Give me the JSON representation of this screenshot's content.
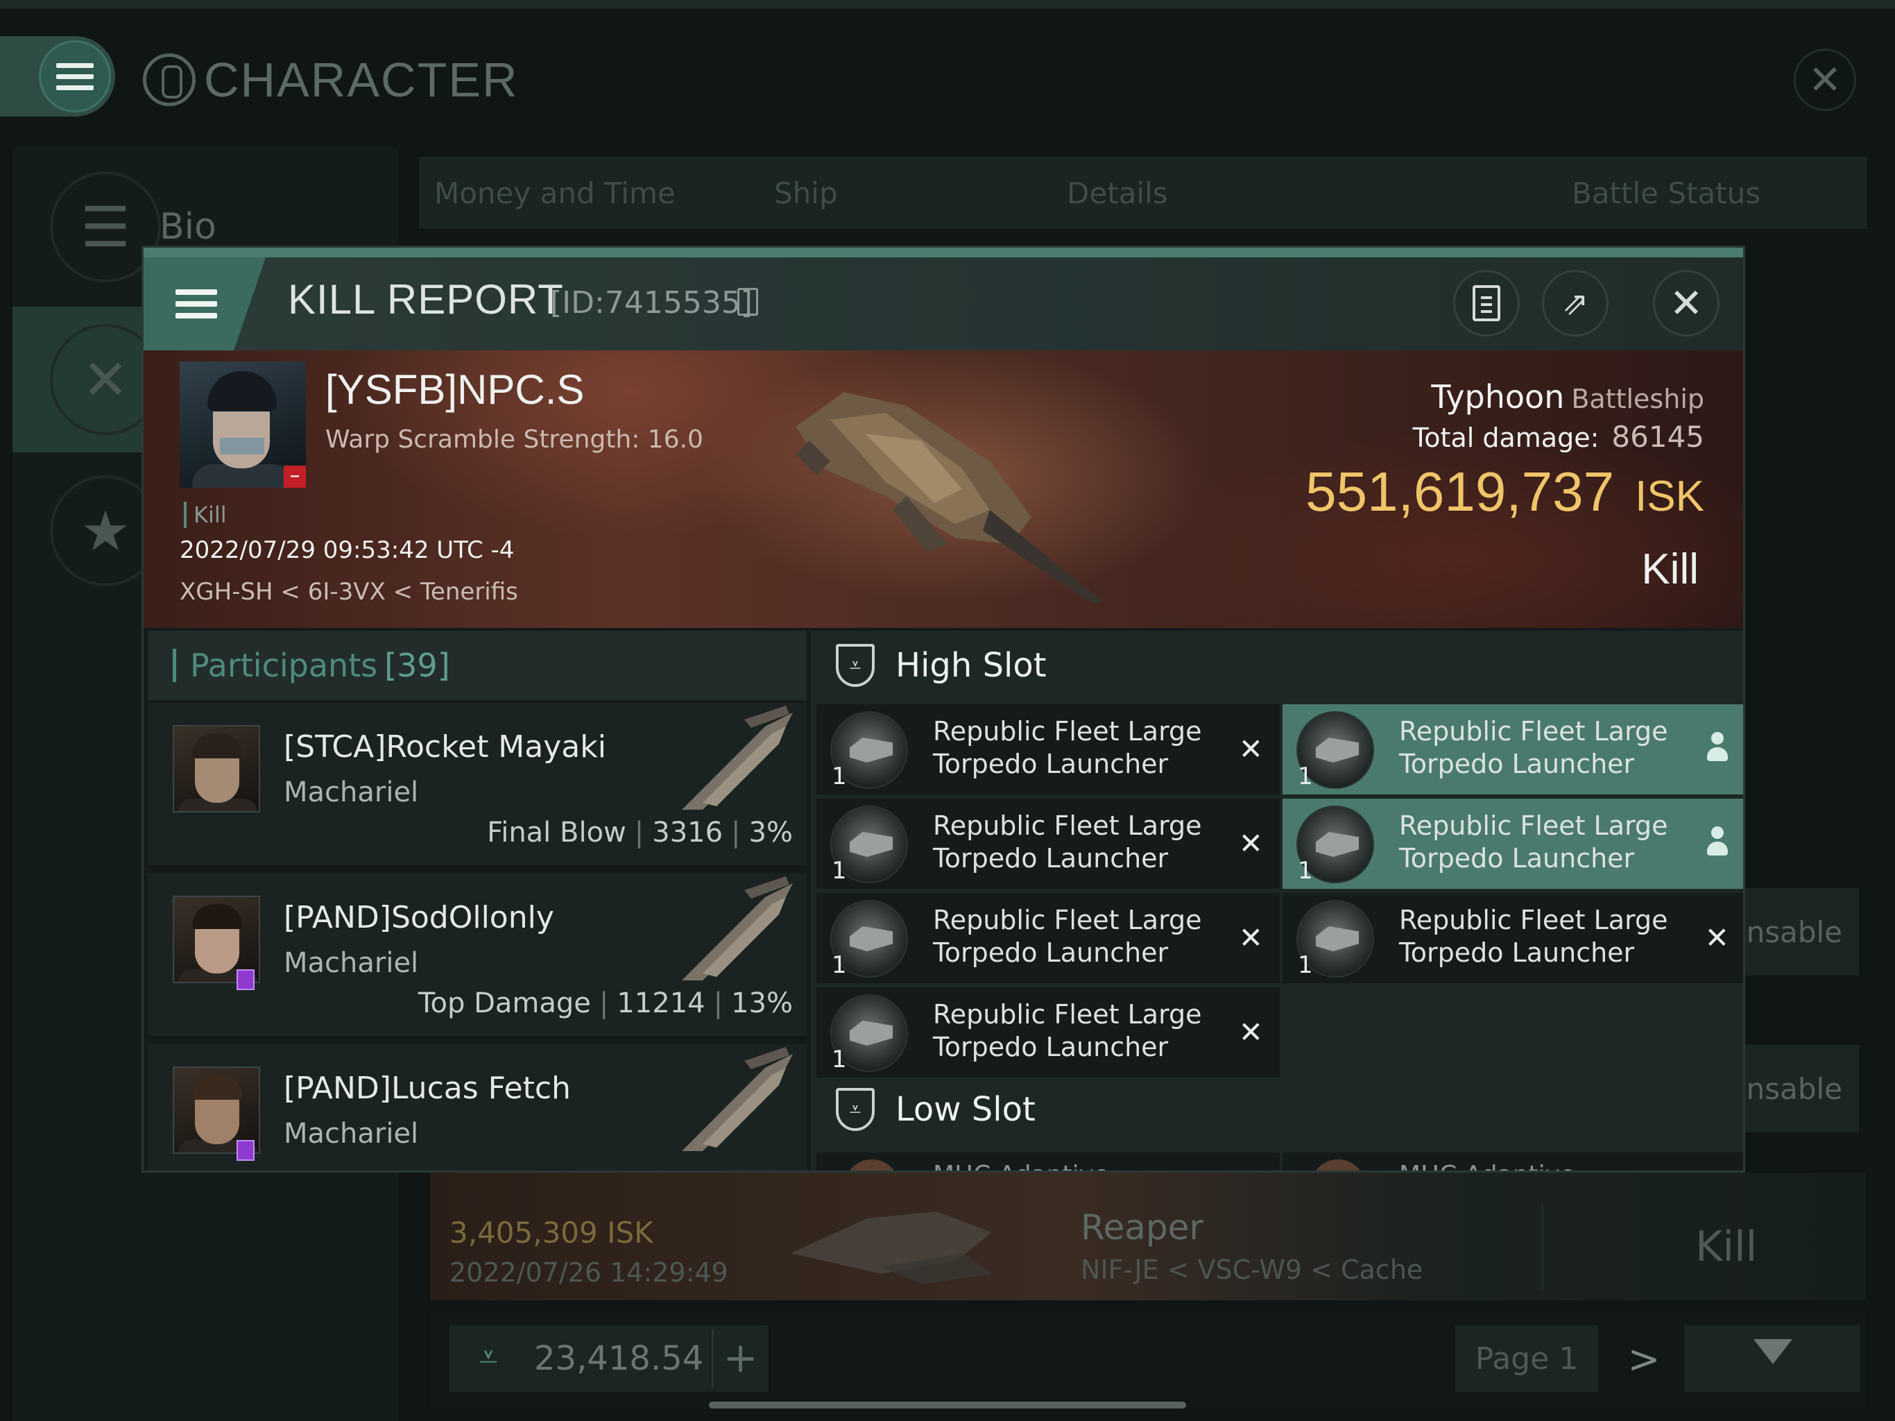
{
  "background": {
    "app_title": "CHARACTER",
    "sidebar": {
      "items": [
        {
          "label": "Bio",
          "icon": "list-icon"
        },
        {
          "label": "",
          "icon": "crossed-swords-icon"
        },
        {
          "label": "",
          "icon": "star-icon"
        }
      ]
    },
    "tabs": [
      "Money and Time",
      "Ship",
      "Details",
      "Battle Status"
    ],
    "side_buttons": [
      "ensable",
      "ensable"
    ],
    "row": {
      "isk": "3,405,309  ISK",
      "date": "2022/07/26  14:29:49",
      "ship": "Reaper",
      "location": "NIF-JE < VSC-W9 < Cache",
      "result": "Kill"
    },
    "wallet_value": "23,418.54",
    "wallet_plus": "+",
    "page_label": "Page 1",
    "next_arrow": ">"
  },
  "kill_report": {
    "title": "KILL REPORT",
    "id": "[ID:7415535]",
    "victim": {
      "name": "[YSFB]NPC.S",
      "warp_scramble": "Warp Scramble Strength: 16.0",
      "tag": "Kill",
      "datetime": "2022/07/29 09:53:42 UTC -4",
      "location": "XGH-SH < 6I-3VX < Tenerifis",
      "ship_name": "Typhoon",
      "ship_class": "Battleship",
      "total_damage_label": "Total damage:",
      "total_damage": "86145",
      "isk_value": "551,619,737",
      "isk_unit": "ISK",
      "result": "Kill"
    },
    "participants": {
      "label": "Participants",
      "count": "[39]",
      "rows": [
        {
          "name": "[STCA]Rocket Mayaki",
          "ship": "Machariel",
          "role": "Final Blow",
          "damage": "3316",
          "pct": "3%"
        },
        {
          "name": "[PAND]SodOllonly",
          "ship": "Machariel",
          "role": "Top Damage",
          "damage": "11214",
          "pct": "13%"
        },
        {
          "name": "[PAND]Lucas Fetch",
          "ship": "Machariel",
          "role": "",
          "damage": "",
          "pct": ""
        }
      ]
    },
    "high_slot": {
      "title": "High Slot",
      "modules": [
        {
          "name": "Republic Fleet Large\nTorpedo Launcher",
          "qty": "1",
          "status": "destroyed"
        },
        {
          "name": "Republic Fleet Large\nTorpedo Launcher",
          "qty": "1",
          "status": "dropped"
        },
        {
          "name": "Republic Fleet Large\nTorpedo Launcher",
          "qty": "1",
          "status": "destroyed"
        },
        {
          "name": "Republic Fleet Large\nTorpedo Launcher",
          "qty": "1",
          "status": "dropped"
        },
        {
          "name": "Republic Fleet Large\nTorpedo Launcher",
          "qty": "1",
          "status": "destroyed"
        },
        {
          "name": "Republic Fleet Large\nTorpedo Launcher",
          "qty": "1",
          "status": "destroyed"
        },
        {
          "name": "Republic Fleet Large\nTorpedo Launcher",
          "qty": "1",
          "status": "destroyed"
        }
      ]
    },
    "low_slot": {
      "title": "Low Slot",
      "peek": [
        "MHC Adaptive",
        "MHC Adaptive"
      ]
    },
    "status_glyphs": {
      "destroyed": "✕"
    },
    "colors": {
      "accent": "#4a7c70",
      "isk": "#f0c56a",
      "selected_row": "#4a7a6e",
      "destroyed_badge": "#c21f26",
      "participant_badge": "#8e3ad0"
    }
  }
}
